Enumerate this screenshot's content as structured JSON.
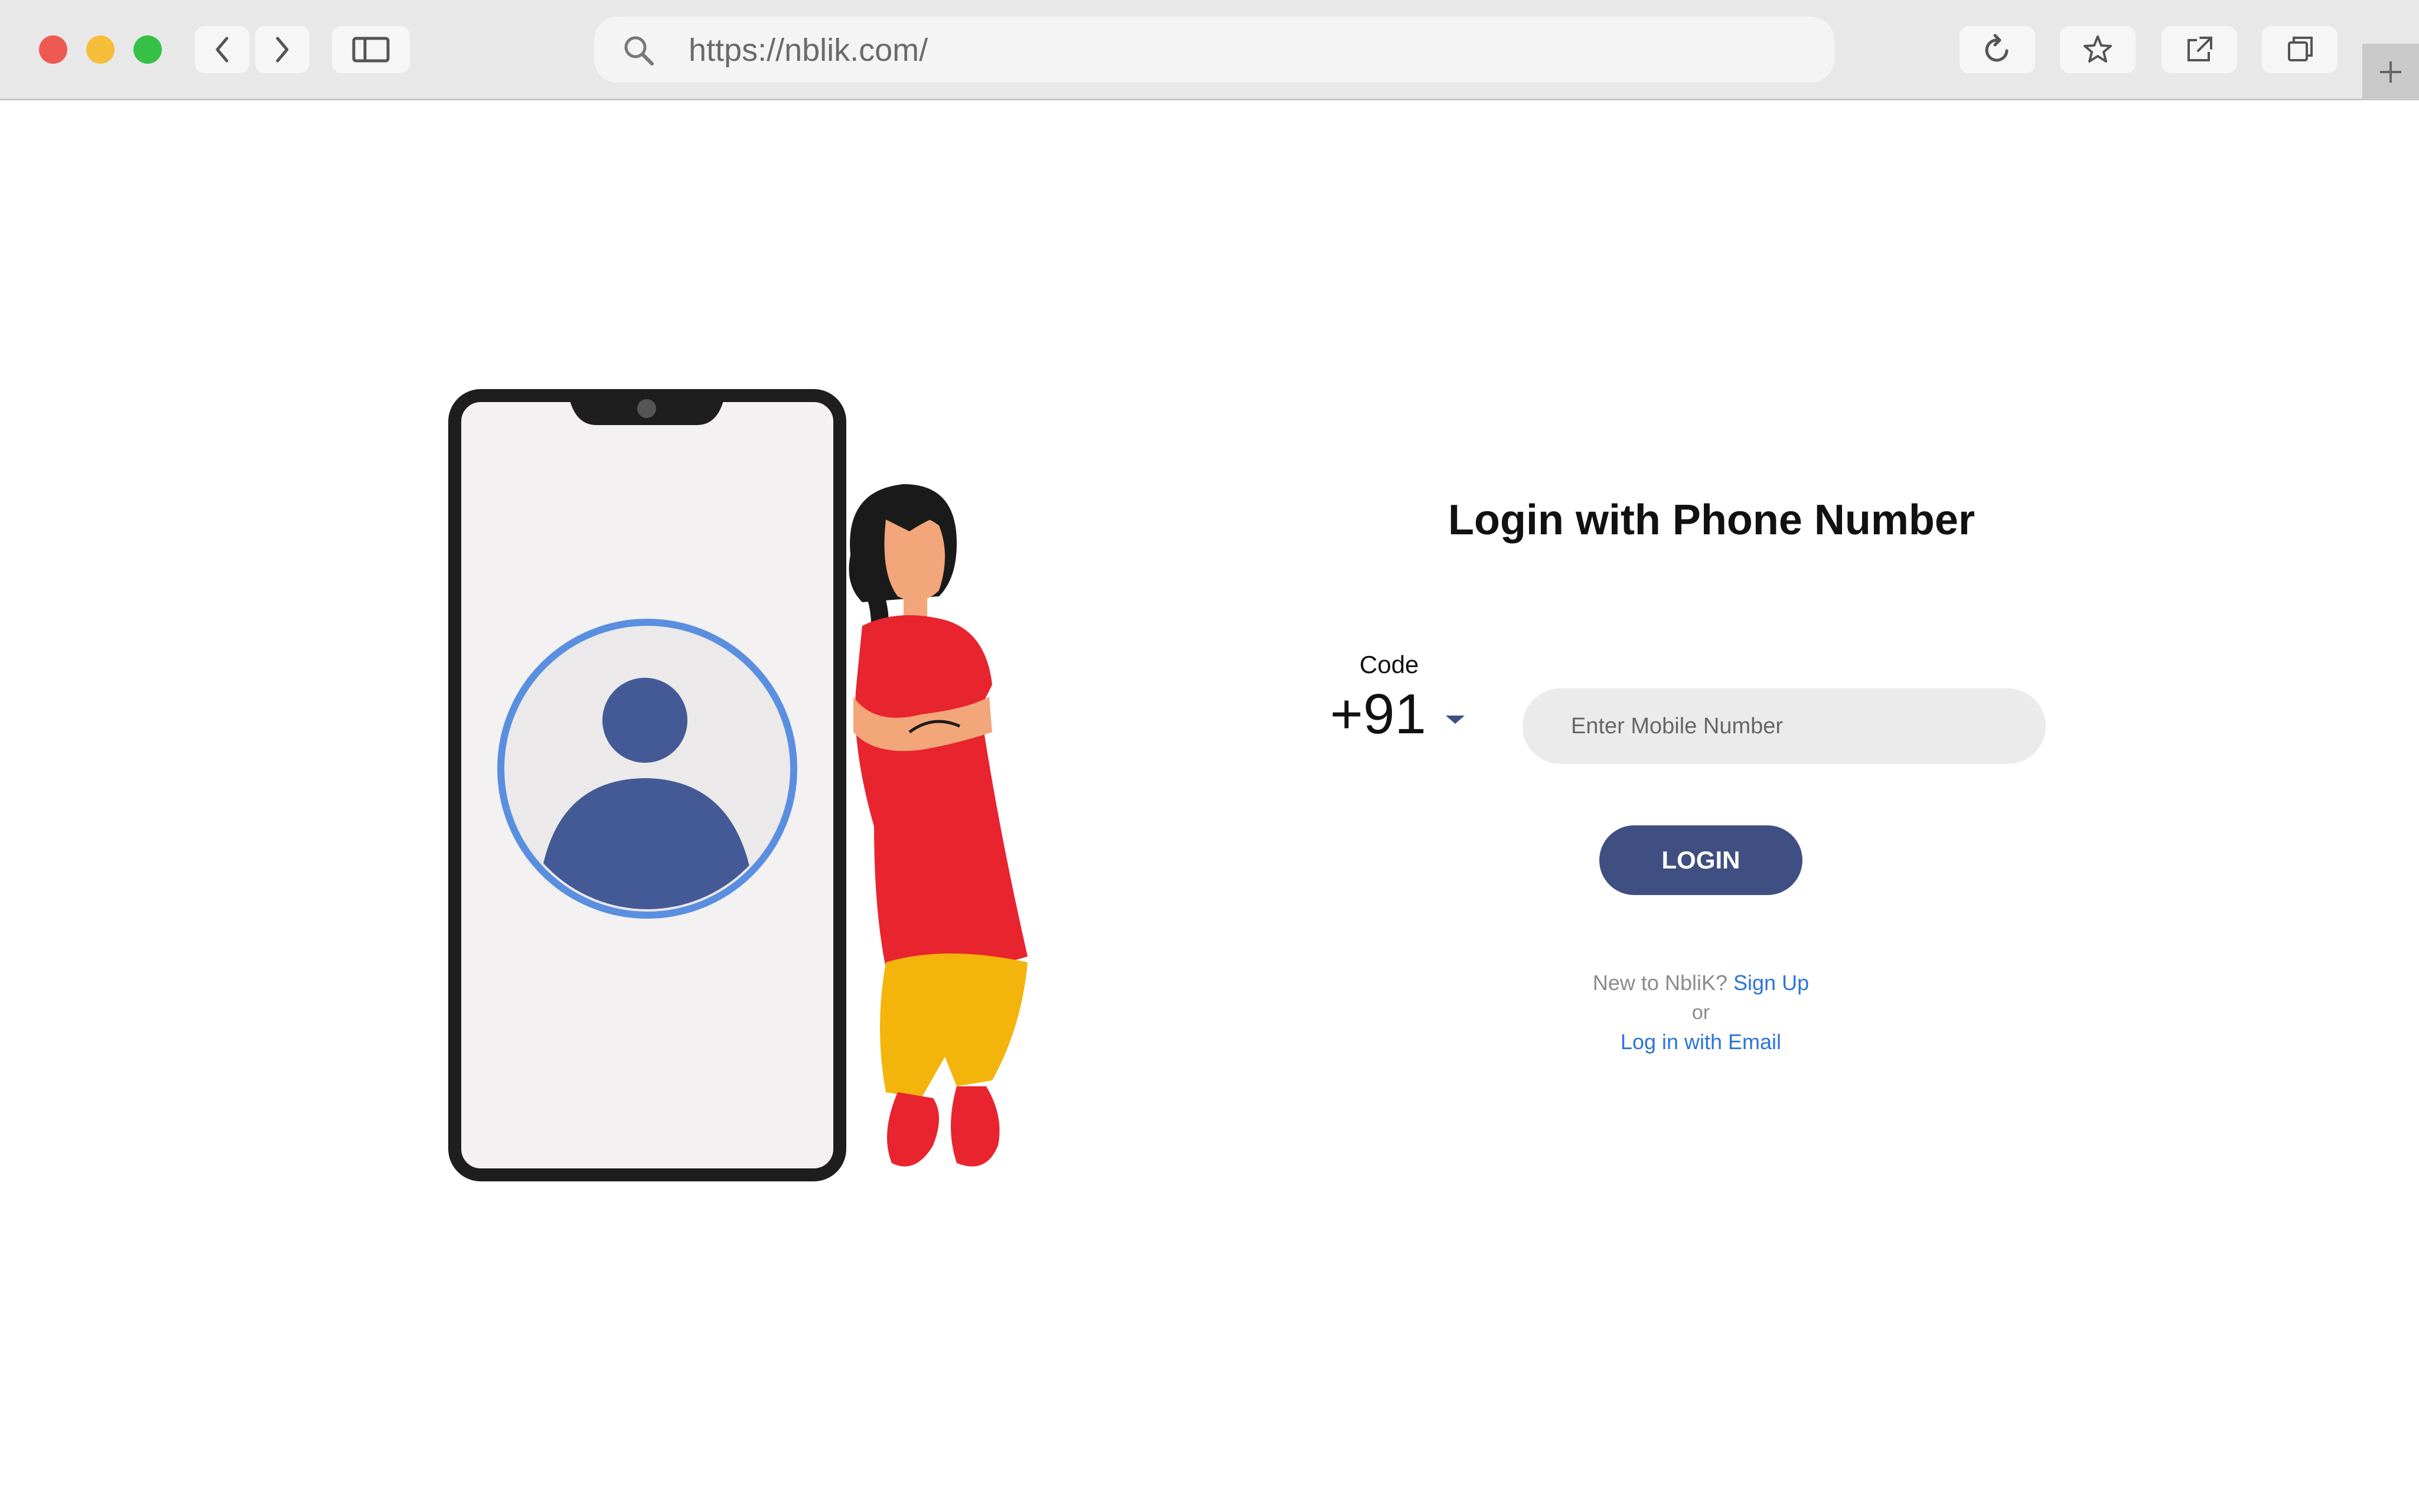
{
  "browser": {
    "url": "https://nblik.com/"
  },
  "login": {
    "title": "Login with Phone Number",
    "code_label": "Code",
    "code_value": "+91",
    "mobile_placeholder": "Enter Mobile Number",
    "login_button": "LOGIN",
    "new_user_text": "New to NbliK?",
    "signup_link": "Sign Up",
    "or_text": "or",
    "email_link": "Log in with Email"
  },
  "colors": {
    "primary_button": "#3f4f82",
    "link": "#2c74d6",
    "input_bg": "#ebebeb"
  },
  "icons": [
    "back-icon",
    "forward-icon",
    "sidebar-icon",
    "search-icon",
    "reload-icon",
    "star-icon",
    "share-icon",
    "tabs-icon",
    "plus-icon",
    "chevron-down-icon"
  ]
}
